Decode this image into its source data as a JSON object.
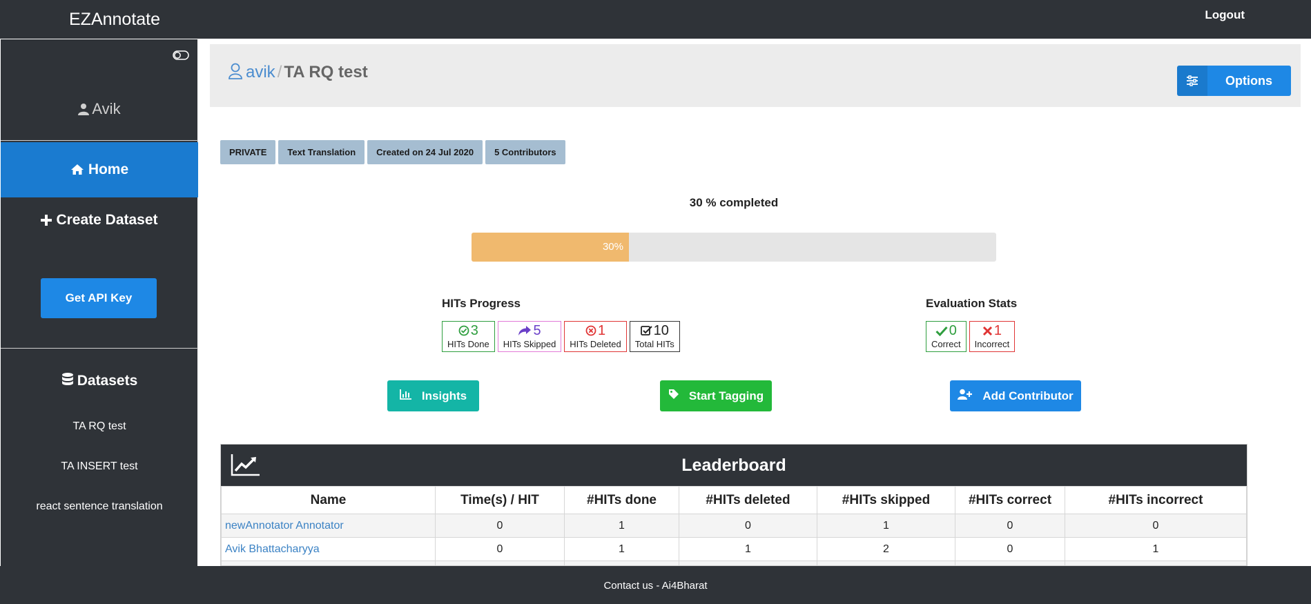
{
  "app": {
    "title": "EZAnnotate",
    "logout_label": "Logout"
  },
  "sidebar": {
    "user_name": "Avik",
    "nav": {
      "home": "Home",
      "create": "Create Dataset"
    },
    "api_key_label": "Get API Key",
    "datasets_heading": "Datasets",
    "datasets": [
      "TA RQ test",
      "TA INSERT test",
      "react sentence translation"
    ]
  },
  "header": {
    "owner": "avik",
    "separator": "/",
    "project": "TA RQ test",
    "options_label": "Options"
  },
  "tags": [
    "PRIVATE",
    "Text Translation",
    "Created on 24 Jul 2020",
    "5 Contributors"
  ],
  "progress": {
    "label": "30 % completed",
    "percent": 30,
    "bar_text": "30%"
  },
  "hits_progress": {
    "title": "HITs Progress",
    "done": {
      "value": "3",
      "label": "HITs Done"
    },
    "skipped": {
      "value": "5",
      "label": "HITs Skipped"
    },
    "deleted": {
      "value": "1",
      "label": "HITs Deleted"
    },
    "total": {
      "value": "10",
      "label": "Total HITs"
    }
  },
  "evaluation": {
    "title": "Evaluation Stats",
    "correct": {
      "value": "0",
      "label": "Correct"
    },
    "incorrect": {
      "value": "1",
      "label": "Incorrect"
    }
  },
  "actions": {
    "insights": "Insights",
    "start_tagging": "Start Tagging",
    "add_contributor": "Add Contributor"
  },
  "leaderboard": {
    "title": "Leaderboard",
    "columns": [
      "Name",
      "Time(s) / HIT",
      "#HITs done",
      "#HITs deleted",
      "#HITs skipped",
      "#HITs correct",
      "#HITs incorrect"
    ],
    "rows": [
      [
        "newAnnotator Annotator",
        "0",
        "1",
        "0",
        "1",
        "0",
        "0"
      ],
      [
        "Avik Bhattacharyya",
        "0",
        "1",
        "1",
        "2",
        "0",
        "1"
      ],
      [
        "",
        "",
        "",
        "",
        "",
        "",
        ""
      ]
    ]
  },
  "footer": {
    "text": "Contact us - Ai4Bharat"
  },
  "colors": {
    "sidebar_bg": "#2f3338",
    "home_active": "#1a7bd0",
    "primary_btn": "#1e88e5",
    "insights_btn": "#14b5a6",
    "tagging_btn": "#23b93a",
    "progress_fill": "#f0b96e",
    "tag_bg": "#a5bdd1"
  }
}
